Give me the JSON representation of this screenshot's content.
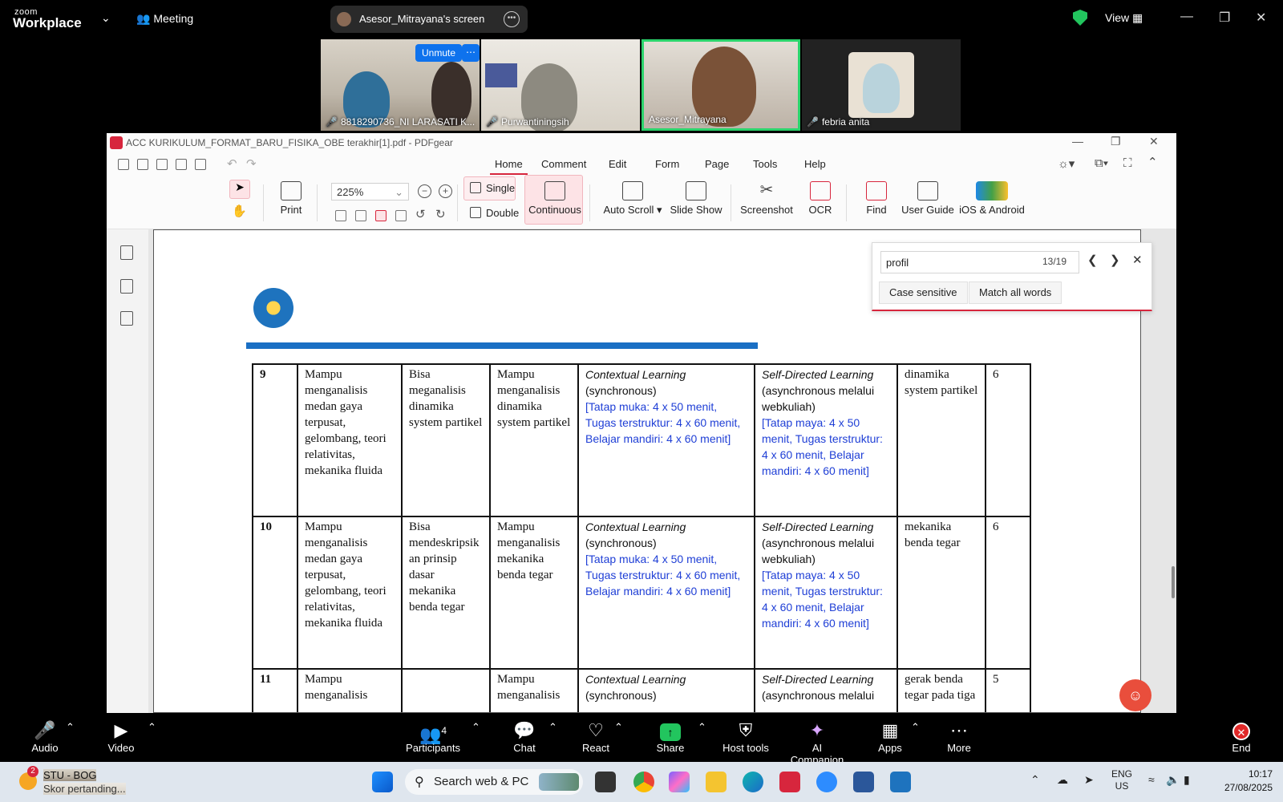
{
  "zoom": {
    "brand_top": "zoom",
    "brand_bottom": "Workplace",
    "meeting_label": "Meeting",
    "share_label": "Asesor_Mitrayana's screen",
    "view_label": "View",
    "unmute_label": "Unmute",
    "participants": [
      {
        "name": "8818290736_NI LARASATI K..."
      },
      {
        "name": "Purwantiningsih"
      },
      {
        "name": "Asesor_Mitrayana"
      },
      {
        "name": "febria anita"
      }
    ],
    "toolbar": {
      "audio": "Audio",
      "video": "Video",
      "participants": "Participants",
      "participants_count": "4",
      "chat": "Chat",
      "react": "React",
      "share": "Share",
      "host_tools": "Host tools",
      "ai_companion": "AI Companion",
      "apps": "Apps",
      "more": "More",
      "end": "End"
    },
    "colors": {
      "share_green": "#22c55e",
      "active_speaker": "#2bd46c",
      "end_red": "#e02828"
    }
  },
  "pdf": {
    "title": "ACC KURIKULUM_FORMAT_BARU_FISIKA_OBE terakhir[1].pdf - PDFgear",
    "menu": [
      "Home",
      "Comment",
      "Edit",
      "Form",
      "Page",
      "Tools",
      "Help"
    ],
    "active_menu": "Home",
    "toolbar": {
      "print": "Print",
      "zoom": "225%",
      "single": "Single",
      "double": "Double",
      "continuous": "Continuous",
      "auto_scroll": "Auto Scroll",
      "slide_show": "Slide Show",
      "screenshot": "Screenshot",
      "ocr": "OCR",
      "find": "Find",
      "user_guide": "User Guide",
      "ios_android": "iOS & Android"
    },
    "find": {
      "query": "profil",
      "count": "13/19",
      "case_sensitive": "Case sensitive",
      "match_all_words": "Match all words"
    },
    "accent": "#d7263d"
  },
  "table": {
    "rows": [
      {
        "no": "9",
        "cpl": "Mampu menganalisis medan gaya terpusat, gelombang, teori relativitas, mekanika fluida",
        "sub": "Bisa meganalisis dinamika system partikel",
        "cpmk": "Mampu menganalisis dinamika system partikel",
        "sync_title": "Contextual Learning",
        "sync_mode": "(synchronous)",
        "sync_detail": "[Tatap muka: 4 x 50 menit, Tugas terstruktur: 4 x 60 menit, Belajar mandiri: 4 x 60 menit]",
        "async_title": "Self-Directed Learning",
        "async_mode": "(asynchronous melalui webkuliah)",
        "async_detail": "[Tatap maya: 4 x 50 menit, Tugas terstruktur: 4 x 60 menit, Belajar mandiri: 4 x 60 menit]",
        "topic": "dinamika system partikel",
        "weight": "6"
      },
      {
        "no": "10",
        "cpl": "Mampu menganalisis medan gaya terpusat, gelombang, teori relativitas, mekanika fluida",
        "sub": "Bisa mendeskripsik an prinsip dasar mekanika benda tegar",
        "cpmk": "Mampu menganalisis mekanika benda tegar",
        "sync_title": "Contextual Learning",
        "sync_mode": "(synchronous)",
        "sync_detail": "[Tatap muka: 4 x 50 menit, Tugas terstruktur: 4 x 60 menit, Belajar mandiri: 4 x 60 menit]",
        "async_title": "Self-Directed Learning",
        "async_mode": "(asynchronous melalui webkuliah)",
        "async_detail": "[Tatap maya: 4 x 50 menit, Tugas terstruktur: 4 x 60 menit, Belajar mandiri: 4 x 60 menit]",
        "topic": "mekanika benda tegar",
        "weight": "6"
      },
      {
        "no": "11",
        "cpl": "Mampu menganalisis",
        "sub": "",
        "cpmk": "Mampu menganalisis",
        "sync_title": "Contextual Learning",
        "sync_mode": "(synchronous)",
        "sync_detail": "",
        "async_title": "Self-Directed Learning",
        "async_mode": "(asynchronous melalui",
        "async_detail": "",
        "topic": "gerak benda tegar pada tiga",
        "weight": "5"
      }
    ]
  },
  "taskbar": {
    "weather_title": "STU - BOG",
    "weather_sub": "Skor pertanding...",
    "weather_badge": "2",
    "search_placeholder": "Search web & PC",
    "lang_top": "ENG",
    "lang_bottom": "US",
    "time": "10:17",
    "date": "27/08/2025"
  }
}
